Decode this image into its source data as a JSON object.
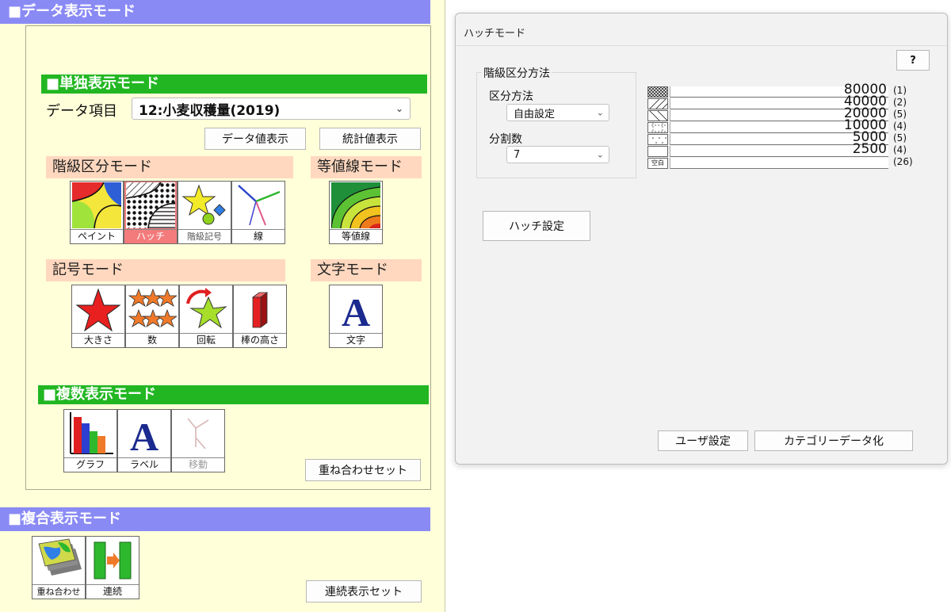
{
  "data_panel": {
    "title": "■データ表示モード",
    "single": {
      "title": "■単独表示モード",
      "item_label": "データ項目",
      "item_value": "12:小麦収穫量(2019)",
      "data_value_button": "データ値表示",
      "stats_button": "統計値表示",
      "class_mode": {
        "title": "階級区分モード",
        "tiles": [
          "ペイント",
          "ハッチ",
          "階級記号",
          "線"
        ]
      },
      "contour_mode": {
        "title": "等値線モード",
        "tiles": [
          "等値線"
        ]
      },
      "symbol_mode": {
        "title": "記号モード",
        "tiles": [
          "大きさ",
          "数",
          "回転",
          "棒の高さ"
        ]
      },
      "text_mode": {
        "title": "文字モード",
        "tiles": [
          "文字"
        ]
      }
    },
    "multi": {
      "title": "■複数表示モード",
      "tiles": [
        "グラフ",
        "ラベル",
        "移動"
      ],
      "overlay_set_button": "重ね合わせセット"
    }
  },
  "composite_panel": {
    "title": "■複合表示モード",
    "tiles": [
      "重ね合わせ",
      "連続"
    ],
    "continuous_set_button": "連続表示セット"
  },
  "hatch_dialog": {
    "title": "ハッチモード",
    "help_button": "?",
    "group_title": "階級区分方法",
    "method_label": "区分方法",
    "method_value": "自由設定",
    "divisions_label": "分割数",
    "divisions_value": "7",
    "legend": [
      {
        "value": "80000",
        "count": "(1)"
      },
      {
        "value": "40000",
        "count": "(2)"
      },
      {
        "value": "20000",
        "count": "(5)"
      },
      {
        "value": "10000",
        "count": "(4)"
      },
      {
        "value": "5000",
        "count": "(5)"
      },
      {
        "value": "2500",
        "count": "(4)"
      },
      {
        "value": "",
        "count": "(26)",
        "swatch_label": "空白"
      }
    ],
    "hatch_settings_button": "ハッチ設定",
    "user_settings_button": "ユーザ設定",
    "categorize_button": "カテゴリーデータ化"
  }
}
